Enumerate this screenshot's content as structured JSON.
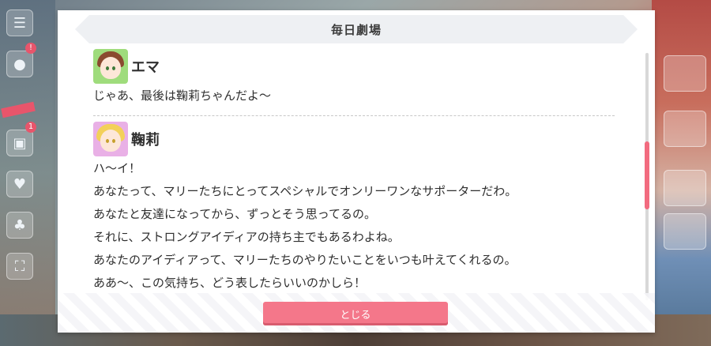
{
  "dialog": {
    "title": "毎日劇場",
    "close_label": "とじる"
  },
  "entries": [
    {
      "speaker": "エマ",
      "avatar": "ema-avatar",
      "lines": [
        "じゃあ、最後は鞠莉ちゃんだよ〜"
      ]
    },
    {
      "speaker": "鞠莉",
      "avatar": "mari-avatar",
      "lines": [
        "ハ〜イ！",
        "あなたって、マリーたちにとってスペシャルでオンリーワンなサポーターだわ。",
        "あなたと友達になってから、ずっとそう思ってるの。",
        "それに、ストロングアイディアの持ち主でもあるわよね。",
        "あなたのアイディアって、マリーたちのやりたいことをいつも叶えてくれるの。",
        "ああ〜、この気持ち、どう表したらいいのかしら！"
      ]
    }
  ],
  "side_badges": [
    "!",
    "1"
  ],
  "colors": {
    "accent": "#f4778a",
    "scroll_thumb": "#f26b7f"
  },
  "icons": [
    "menu-icon",
    "chat-icon",
    "gift-icon",
    "heart-icon",
    "tree-icon",
    "fullscreen-icon"
  ]
}
